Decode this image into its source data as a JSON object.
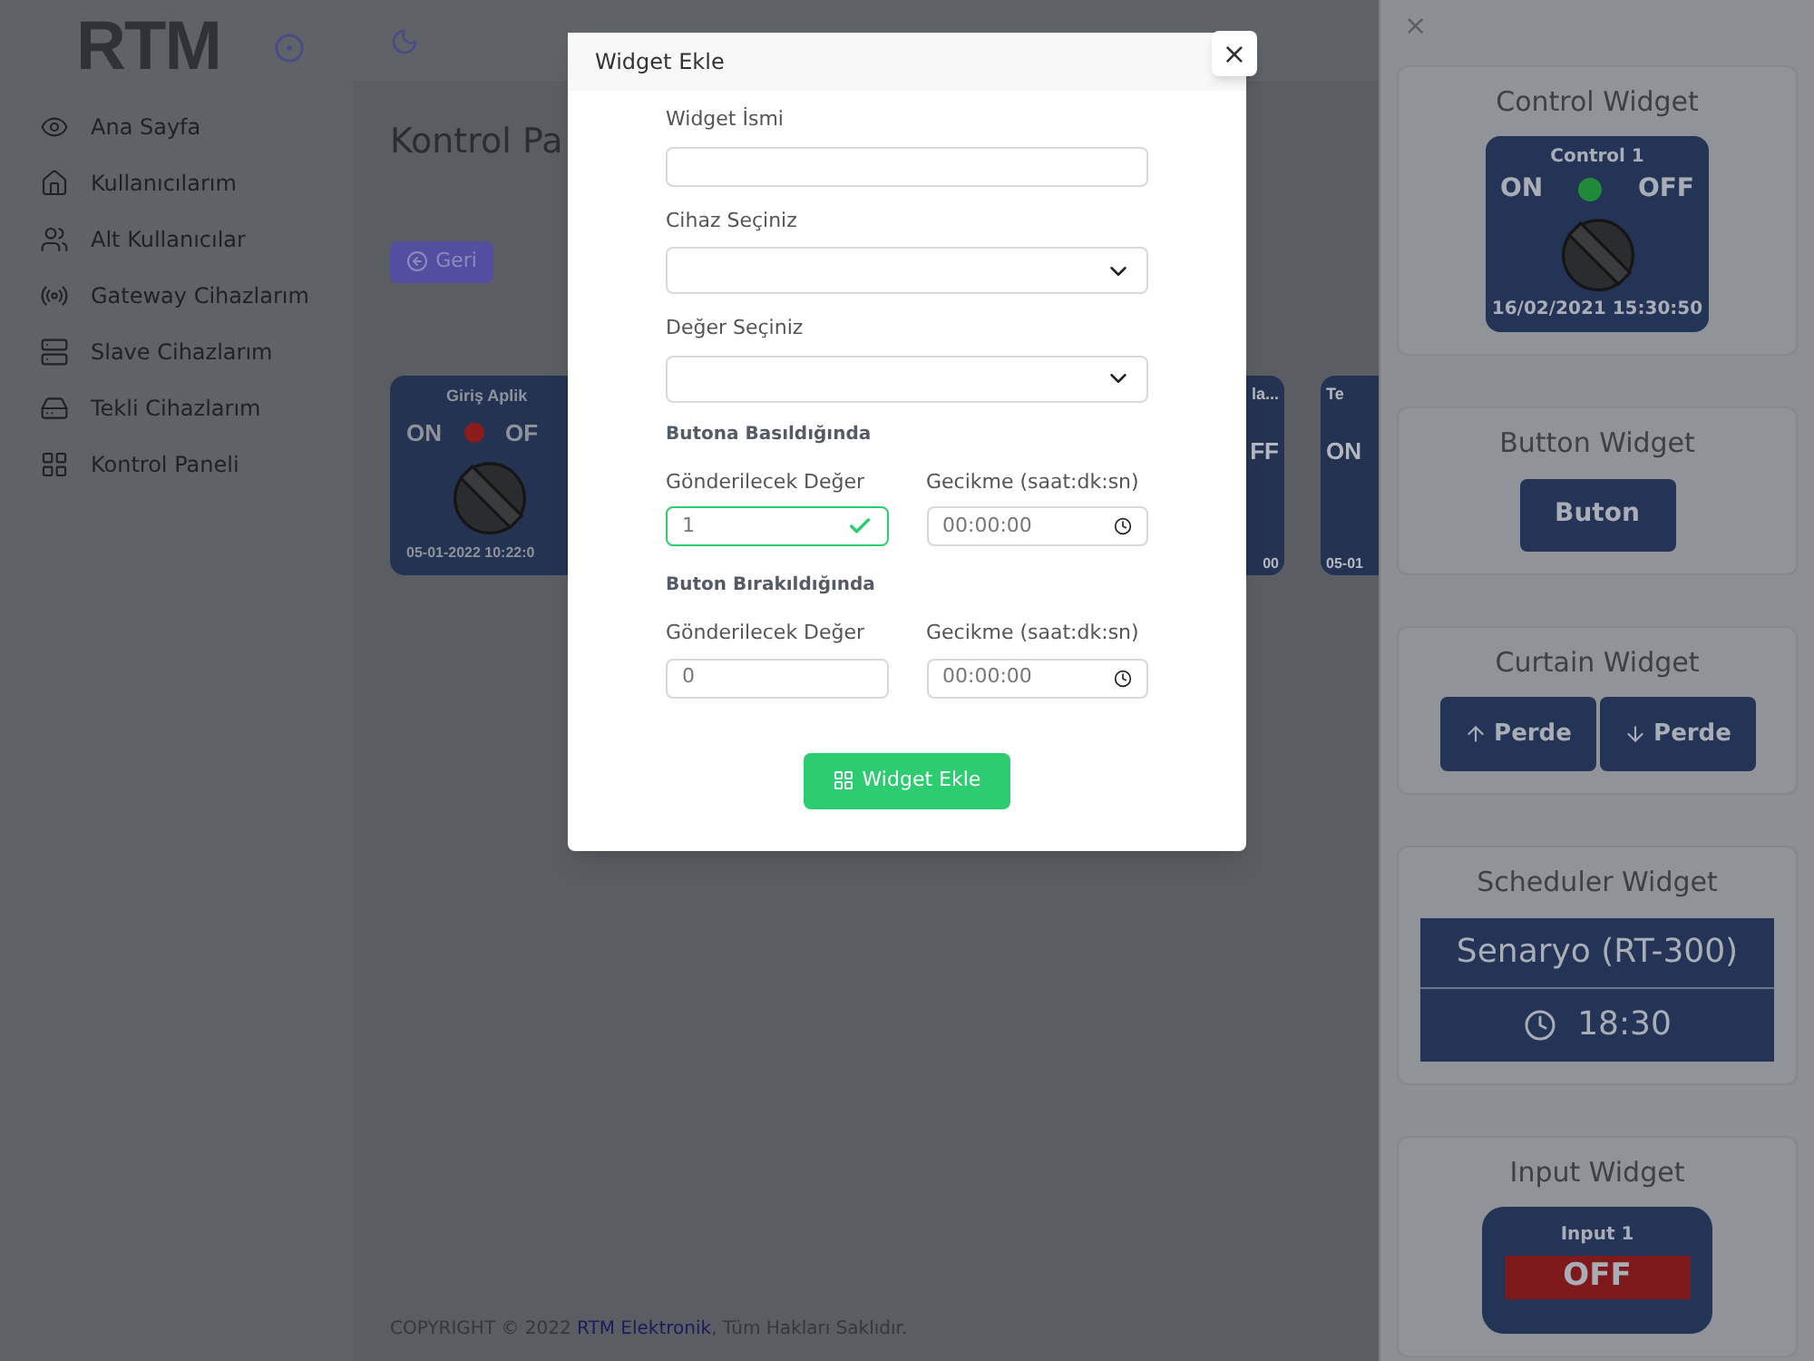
{
  "sidebar": {
    "logo": "RTM",
    "items": [
      {
        "label": "Ana Sayfa"
      },
      {
        "label": "Kullanıcılarım"
      },
      {
        "label": "Alt Kullanıcılar"
      },
      {
        "label": "Gateway Cihazlarım"
      },
      {
        "label": "Slave Cihazlarım"
      },
      {
        "label": "Tekli Cihazlarım"
      },
      {
        "label": "Kontrol Paneli"
      }
    ]
  },
  "page": {
    "title": "Kontrol Pa",
    "back_button": "Geri",
    "cards": [
      {
        "title": "Giriş Aplik",
        "on": "ON",
        "off": "OF",
        "time": "05-01-2022 10:22:0",
        "color": "#8b1c1c"
      }
    ],
    "partial_cards": [
      {
        "title": "la...",
        "state": "FF",
        "time": "00"
      },
      {
        "title": "Te",
        "state": "ON",
        "time": "05-01"
      }
    ]
  },
  "footer": {
    "copyright": "COPYRIGHT © 2022",
    "link": "RTM Elektronik",
    "rest": ", Tüm Hakları Saklıdır."
  },
  "modal": {
    "title": "Widget Ekle",
    "close": "×",
    "name_label": "Widget İsmi",
    "device_label": "Cihaz Seçiniz",
    "value_label": "Değer Seçiniz",
    "sections": [
      {
        "title": "Butona Basıldığında",
        "send_label": "Gönderilecek Değer",
        "send_value": "1",
        "valid": true,
        "delay_label": "Gecikme (saat:dk:sn)",
        "delay_value": "00:00:00"
      },
      {
        "title": "Buton Bırakıldığında",
        "send_label": "Gönderilecek Değer",
        "send_value": "0",
        "valid": false,
        "delay_label": "Gecikme (saat:dk:sn)",
        "delay_value": "00:00:00"
      }
    ],
    "submit": "Widget Ekle"
  },
  "drawer": {
    "close": "×",
    "widgets": [
      {
        "kind": "control",
        "title": "Control Widget",
        "name": "Control 1",
        "on": "ON",
        "off": "OFF",
        "time": "16/02/2021 15:30:50",
        "color": "#1f8a3a"
      },
      {
        "kind": "button",
        "title": "Button Widget",
        "button": "Buton"
      },
      {
        "kind": "curtain",
        "title": "Curtain Widget",
        "up": "Perde",
        "down": "Perde"
      },
      {
        "kind": "scheduler",
        "title": "Scheduler Widget",
        "scenario": "Senaryo (RT-300)",
        "time": "18:30"
      },
      {
        "kind": "input",
        "title": "Input Widget",
        "name": "Input 1",
        "state": "OFF"
      }
    ]
  }
}
